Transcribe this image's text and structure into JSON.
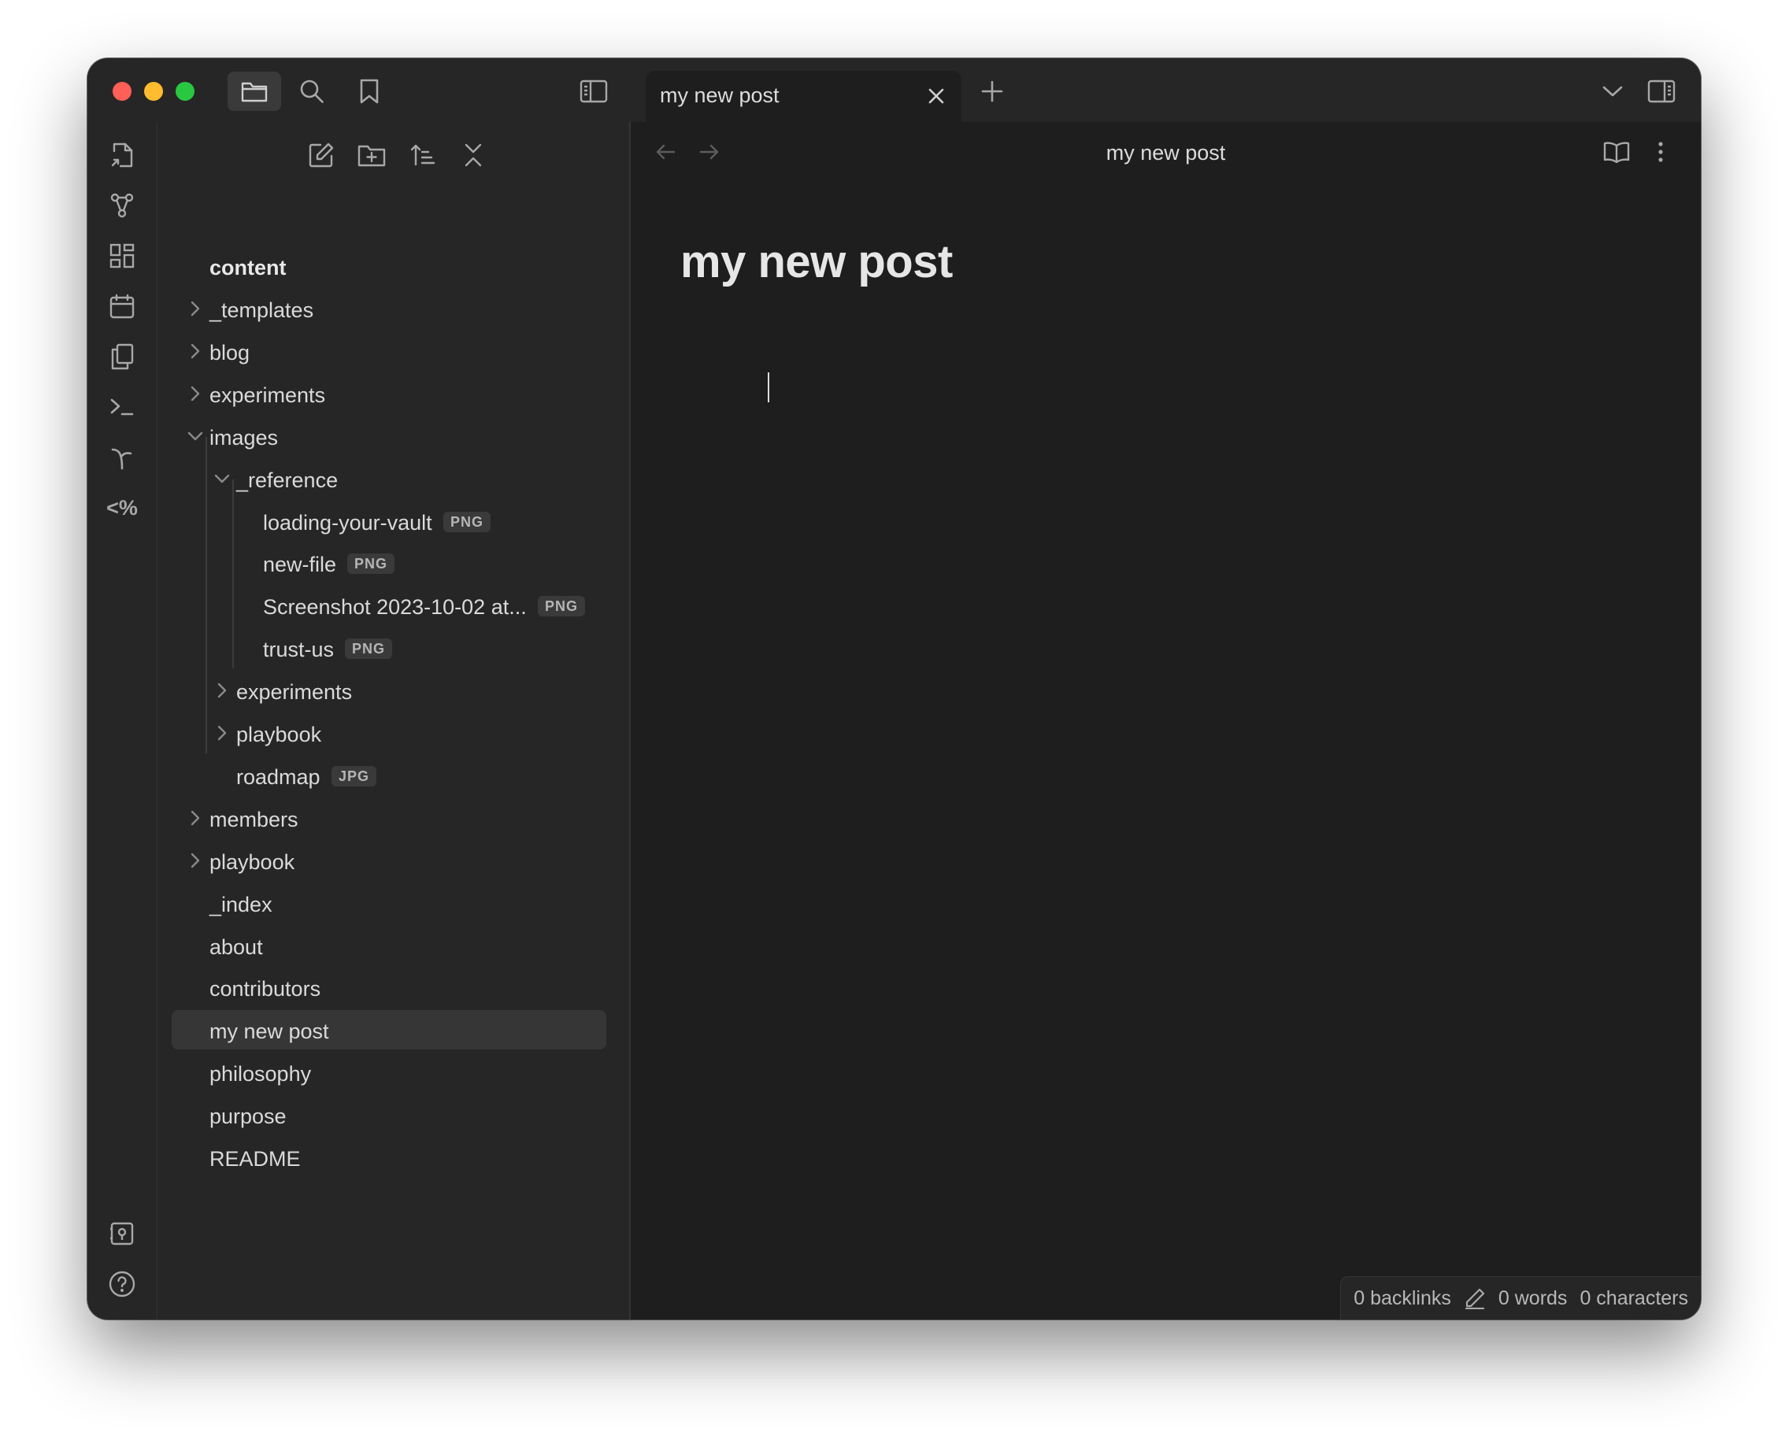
{
  "tab": {
    "title": "my new post",
    "new_tab_symbol": "+"
  },
  "view_header": {
    "title": "my new post"
  },
  "document": {
    "title": "my new post"
  },
  "file_tree": {
    "root": "content",
    "items": [
      {
        "label": "_templates",
        "kind": "folder",
        "expanded": false,
        "depth": 0
      },
      {
        "label": "blog",
        "kind": "folder",
        "expanded": false,
        "depth": 0
      },
      {
        "label": "experiments",
        "kind": "folder",
        "expanded": false,
        "depth": 0
      },
      {
        "label": "images",
        "kind": "folder",
        "expanded": true,
        "depth": 0
      },
      {
        "label": "_reference",
        "kind": "folder",
        "expanded": true,
        "depth": 1
      },
      {
        "label": "loading-your-vault",
        "kind": "file",
        "badge": "PNG",
        "depth": 2
      },
      {
        "label": "new-file",
        "kind": "file",
        "badge": "PNG",
        "depth": 2
      },
      {
        "label": "Screenshot 2023-10-02 at...",
        "kind": "file",
        "badge": "PNG",
        "depth": 2
      },
      {
        "label": "trust-us",
        "kind": "file",
        "badge": "PNG",
        "depth": 2
      },
      {
        "label": "experiments",
        "kind": "folder",
        "expanded": false,
        "depth": 1
      },
      {
        "label": "playbook",
        "kind": "folder",
        "expanded": false,
        "depth": 1
      },
      {
        "label": "roadmap",
        "kind": "file",
        "badge": "JPG",
        "depth": 1
      },
      {
        "label": "members",
        "kind": "folder",
        "expanded": false,
        "depth": 0
      },
      {
        "label": "playbook",
        "kind": "folder",
        "expanded": false,
        "depth": 0
      },
      {
        "label": "_index",
        "kind": "file",
        "depth": 0
      },
      {
        "label": "about",
        "kind": "file",
        "depth": 0
      },
      {
        "label": "contributors",
        "kind": "file",
        "depth": 0
      },
      {
        "label": "my new post",
        "kind": "file",
        "depth": 0,
        "selected": true
      },
      {
        "label": "philosophy",
        "kind": "file",
        "depth": 0
      },
      {
        "label": "purpose",
        "kind": "file",
        "depth": 0
      },
      {
        "label": "README",
        "kind": "file",
        "depth": 0
      }
    ]
  },
  "ribbon": {
    "top_icons": [
      "open-quick-switcher-icon",
      "graph-view-icon",
      "canvas-icon",
      "daily-note-icon",
      "templates-icon",
      "command-palette-icon",
      "git-branch-icon",
      "templater-icon"
    ],
    "templater_glyph": "<%",
    "bottom_icons": [
      "vault-switcher-icon",
      "help-icon",
      "settings-icon"
    ]
  },
  "status_bar": {
    "backlinks": "0 backlinks",
    "words": "0 words",
    "characters": "0 characters"
  },
  "colors": {
    "background": "#1e1e1e",
    "panel": "#262626",
    "text": "#dadada",
    "selected_row": "#363636",
    "traffic_red": "#fe5f57",
    "traffic_yellow": "#febc2e",
    "traffic_green": "#28c840"
  }
}
